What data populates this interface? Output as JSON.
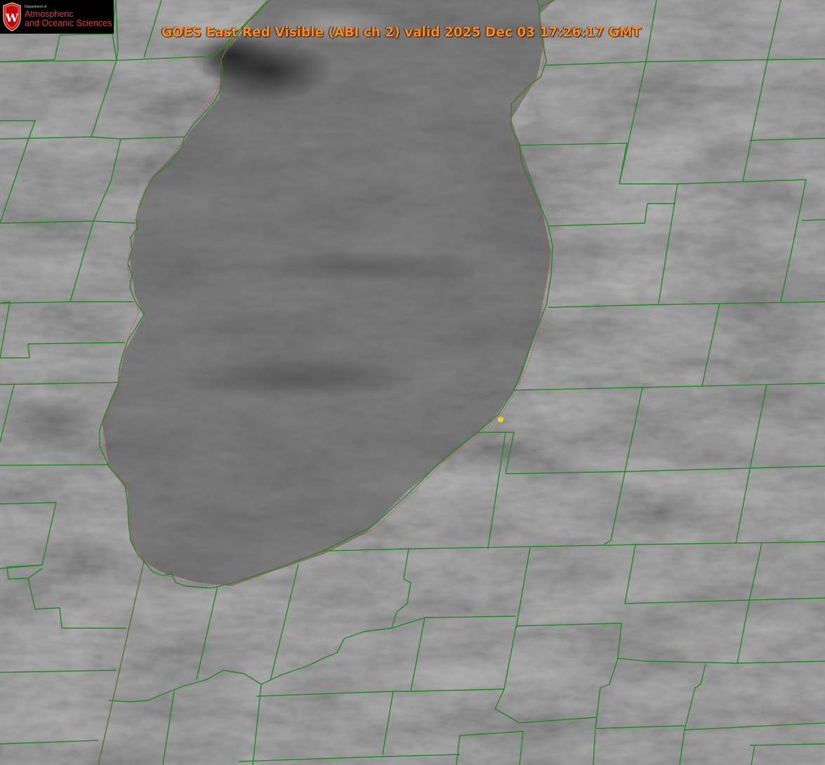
{
  "title": "GOES East Red Visible (ABI ch 2) valid 2025 Dec 03 17:26:17 GMT",
  "logo": {
    "dept": "Department of",
    "line1": "Atmospheric",
    "line2": "and Oceanic Sciences",
    "seal_letter": "W"
  },
  "colors": {
    "boundary": "#1f8a1f",
    "coastline_dotted": "#d0453a",
    "marker": "#e2d52a",
    "title": "#ff8a1e",
    "logo_text": "#e0393e"
  },
  "layers": [
    "satellite-visible-imagery",
    "county-boundaries",
    "lake-shoreline",
    "location-marker"
  ]
}
